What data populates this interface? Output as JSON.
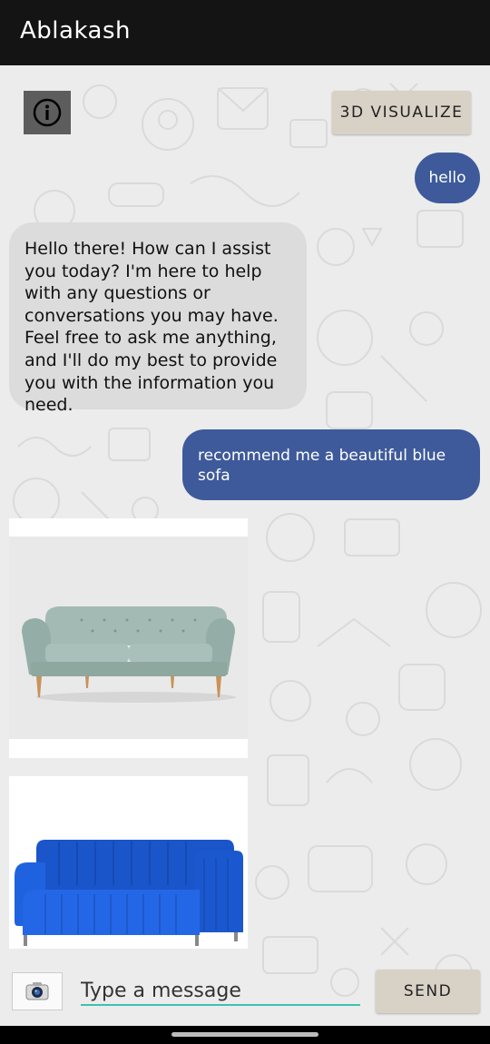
{
  "app": {
    "title": "Ablakash"
  },
  "toolbar": {
    "visualize_label": "3D VISUALIZE"
  },
  "messages": [
    {
      "from": "user",
      "text": "hello"
    },
    {
      "from": "bot",
      "text": "Hello there! How can I assist you today? I'm here to help with any questions or conversations you may have. Feel free to ask me anything, and I'll do my best to provide you with the information you need."
    },
    {
      "from": "user",
      "text": "recommend me a beautiful blue sofa"
    }
  ],
  "results": [
    {
      "kind": "sofa-image",
      "color": "#9fb8b2"
    },
    {
      "kind": "sofa-image",
      "color": "#1f5fd6"
    }
  ],
  "composer": {
    "placeholder": "Type a message",
    "value": "",
    "send_label": "SEND"
  },
  "colors": {
    "accent": "#3e5a9a",
    "input_underline": "#3cc1b0",
    "button_bg": "#d8d1c6"
  }
}
